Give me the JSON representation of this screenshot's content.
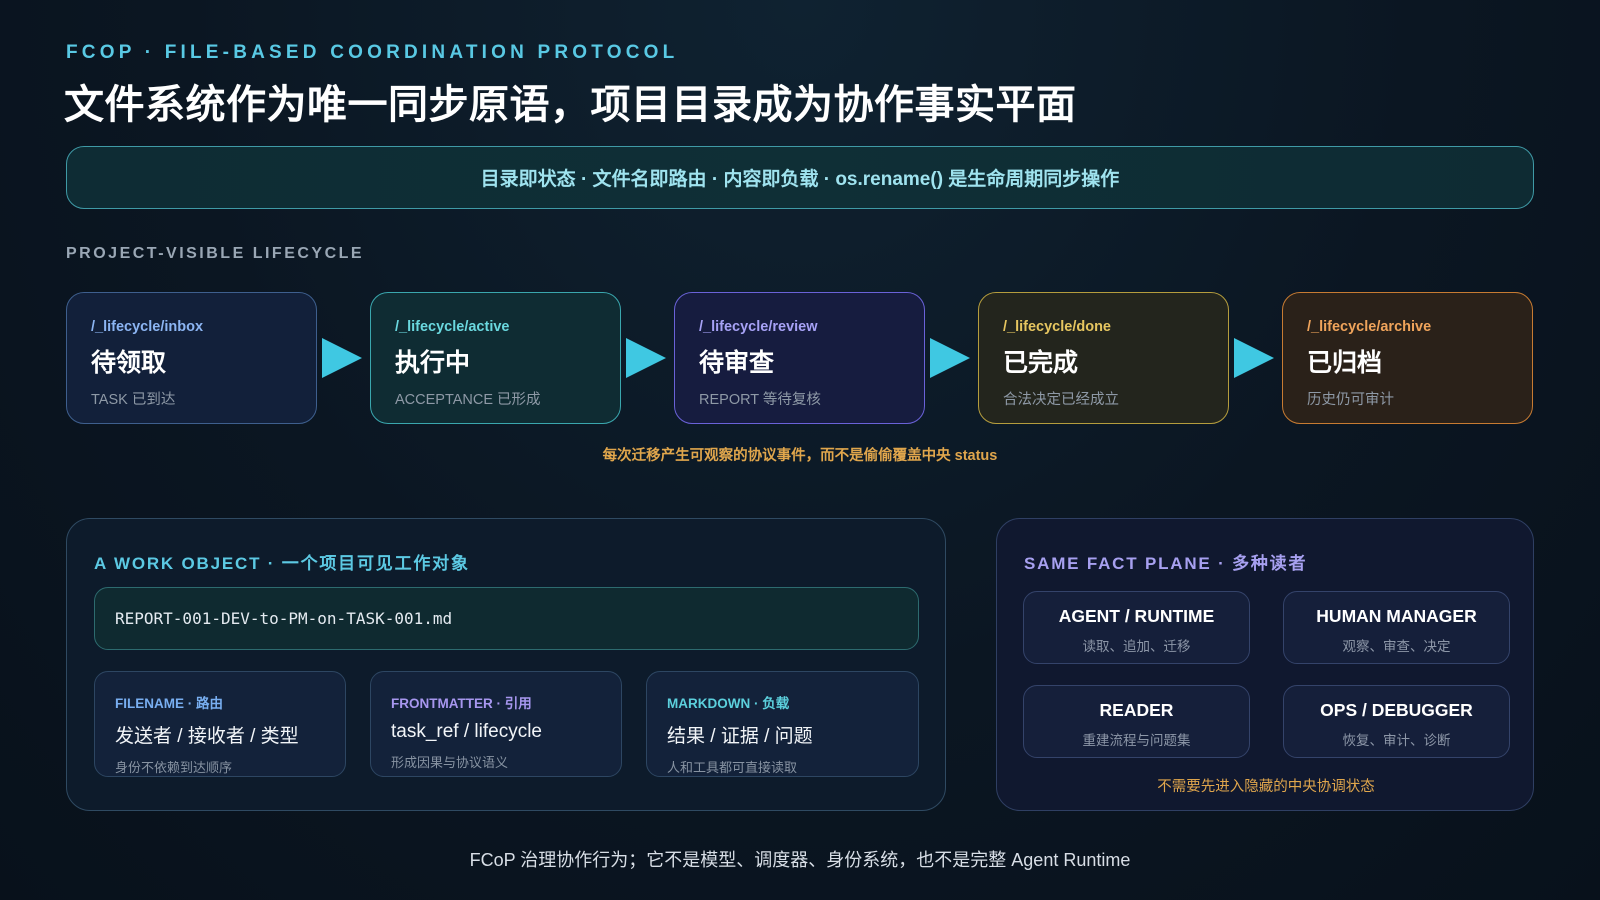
{
  "header": {
    "kicker": "FCOP · FILE-BASED COORDINATION PROTOCOL",
    "title": "文件系统作为唯一同步原语，项目目录成为协作事实平面"
  },
  "banner": "目录即状态 · 文件名即路由 · 内容即负载 · os.rename() 是生命周期同步操作",
  "lifecycle": {
    "label": "PROJECT-VISIBLE LIFECYCLE",
    "stages": [
      {
        "path": "/_lifecycle/inbox",
        "name": "待领取",
        "desc": "TASK 已到达"
      },
      {
        "path": "/_lifecycle/active",
        "name": "执行中",
        "desc": "ACCEPTANCE 已形成"
      },
      {
        "path": "/_lifecycle/review",
        "name": "待审查",
        "desc": "REPORT 等待复核"
      },
      {
        "path": "/_lifecycle/done",
        "name": "已完成",
        "desc": "合法决定已经成立"
      },
      {
        "path": "/_lifecycle/archive",
        "name": "已归档",
        "desc": "历史仍可审计"
      }
    ],
    "note": "每次迁移产生可观察的协议事件，而不是偷偷覆盖中央 status"
  },
  "work_object": {
    "heading": "A WORK OBJECT · 一个项目可见工作对象",
    "filename": "REPORT-001-DEV-to-PM-on-TASK-001.md",
    "parts": [
      {
        "tag": "FILENAME · 路由",
        "main": "发送者 / 接收者 / 类型",
        "sub": "身份不依赖到达顺序"
      },
      {
        "tag": "FRONTMATTER · 引用",
        "main": "task_ref / lifecycle",
        "sub": "形成因果与协议语义"
      },
      {
        "tag": "MARKDOWN · 负载",
        "main": "结果 / 证据 / 问题",
        "sub": "人和工具都可直接读取"
      }
    ]
  },
  "fact_plane": {
    "heading": "SAME FACT PLANE · 多种读者",
    "readers": [
      {
        "name": "AGENT / RUNTIME",
        "sub": "读取、追加、迁移"
      },
      {
        "name": "HUMAN MANAGER",
        "sub": "观察、审查、决定"
      },
      {
        "name": "READER",
        "sub": "重建流程与问题集"
      },
      {
        "name": "OPS / DEBUGGER",
        "sub": "恢复、审计、诊断"
      }
    ],
    "note": "不需要先进入隐藏的中央协调状态"
  },
  "footer": "FCoP 治理协作行为；它不是模型、调度器、身份系统，也不是完整 Agent Runtime",
  "colors": {
    "accent_cyan": "#59c9e4",
    "inbox": "#8cb5f3",
    "active": "#6ad8df",
    "review": "#a7a2f6",
    "done": "#e6c660",
    "archive": "#f0a45b",
    "note_amber": "#e0a64c"
  }
}
